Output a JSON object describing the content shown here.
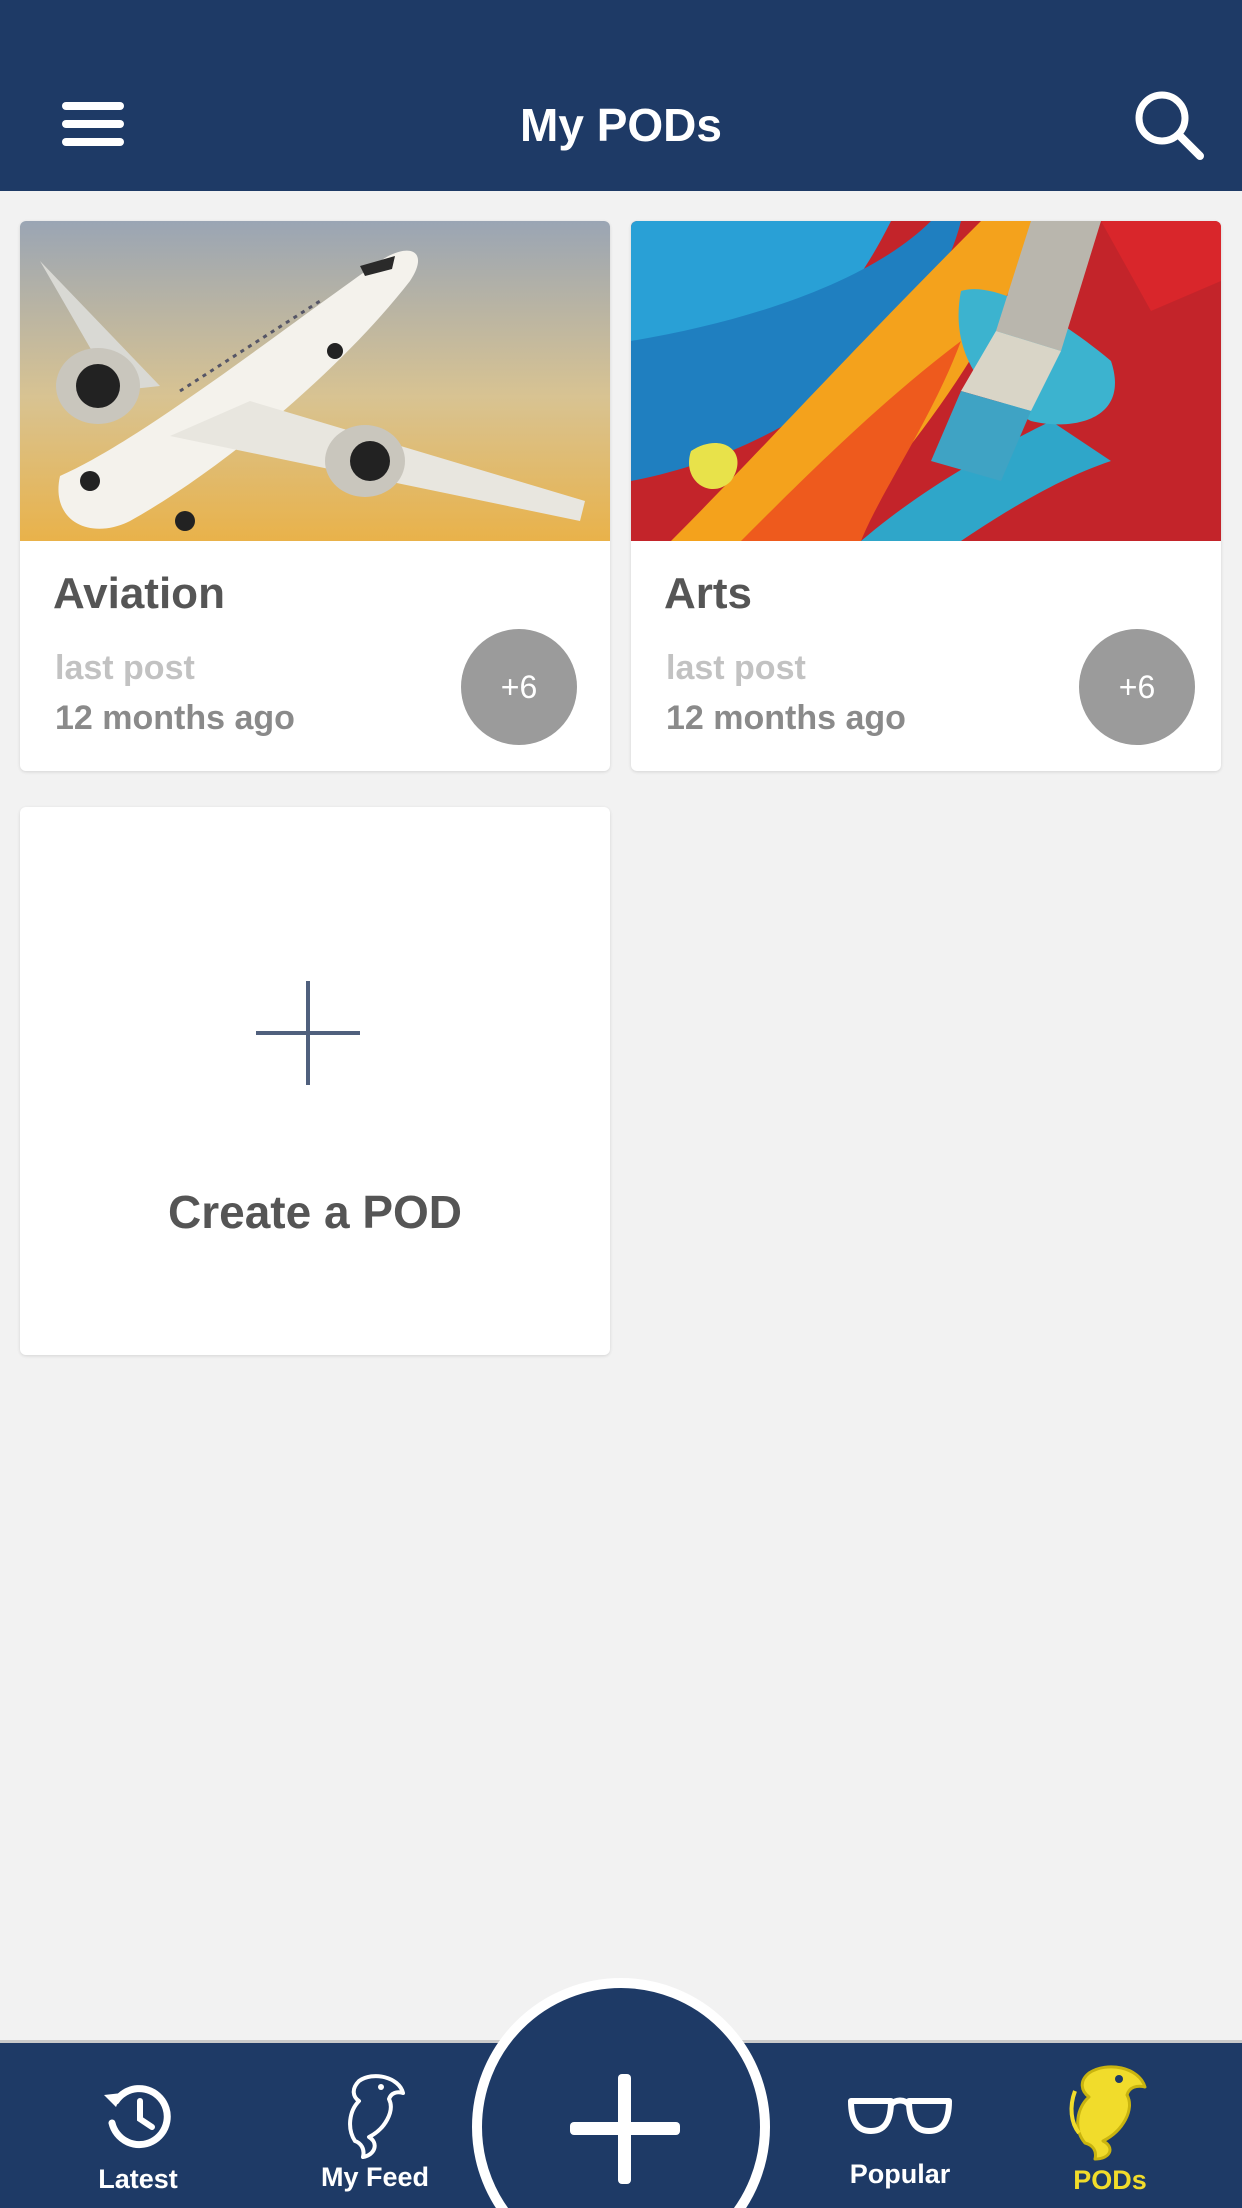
{
  "header": {
    "title": "My PODs",
    "menu_icon": "hamburger-menu-icon",
    "search_icon": "search-icon"
  },
  "pods": [
    {
      "name": "Aviation",
      "image": "airplane-photo",
      "last_post_label": "last post",
      "last_post_time": "12 months ago",
      "member_badge": "+6"
    },
    {
      "name": "Arts",
      "image": "paint-brush-photo",
      "last_post_label": "last post",
      "last_post_time": "12 months ago",
      "member_badge": "+6"
    }
  ],
  "create_card": {
    "label": "Create a POD",
    "icon": "plus-icon"
  },
  "bottom_nav": {
    "items": [
      {
        "label": "Latest",
        "icon": "history-clock-icon",
        "active": false
      },
      {
        "label": "My Feed",
        "icon": "dolphin-icon",
        "active": false
      },
      {
        "label": "Popular",
        "icon": "glasses-icon",
        "active": false
      },
      {
        "label": "PODs",
        "icon": "dolphin-icon",
        "active": true
      }
    ],
    "fab_icon": "plus-icon"
  },
  "colors": {
    "primary": "#1e3a66",
    "background": "#f2f2f2",
    "active_tab": "#f1dc2b",
    "badge": "#9b9b9b"
  }
}
